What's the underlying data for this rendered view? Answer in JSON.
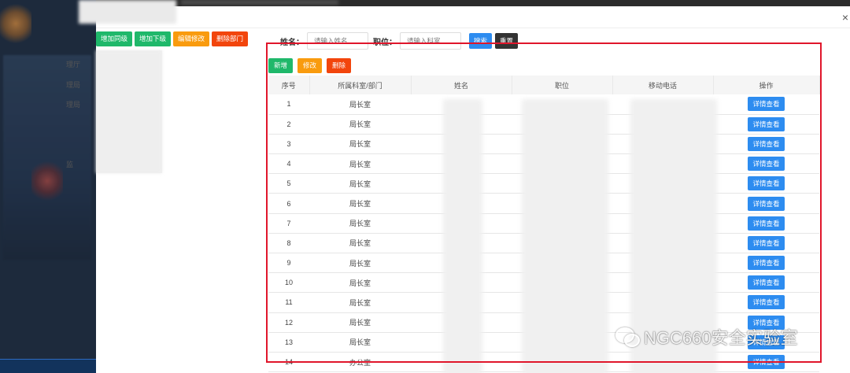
{
  "tree_toolbar": {
    "add_sibling": "增加同级",
    "add_child": "增加下级",
    "edit": "编辑修改",
    "delete_dept": "删除部门"
  },
  "tree": {
    "items": [
      "理厅",
      "理局",
      "理局",
      "监"
    ]
  },
  "search": {
    "name_label": "姓名：",
    "name_placeholder": "请输入姓名",
    "position_label": "职位：",
    "position_placeholder": "请输入科室",
    "search_button": "搜索",
    "reset_button": "重置"
  },
  "content_toolbar": {
    "add": "新增",
    "edit": "修改",
    "delete": "删除"
  },
  "table": {
    "headers": [
      "序号",
      "所属科室/部门",
      "姓名",
      "职位",
      "移动电话",
      "操作"
    ],
    "detail_label": "详情查看",
    "rows": [
      {
        "idx": "1",
        "dept": "局长室"
      },
      {
        "idx": "2",
        "dept": "局长室"
      },
      {
        "idx": "3",
        "dept": "局长室"
      },
      {
        "idx": "4",
        "dept": "局长室"
      },
      {
        "idx": "5",
        "dept": "局长室"
      },
      {
        "idx": "6",
        "dept": "局长室"
      },
      {
        "idx": "7",
        "dept": "局长室"
      },
      {
        "idx": "8",
        "dept": "局长室"
      },
      {
        "idx": "9",
        "dept": "局长室"
      },
      {
        "idx": "10",
        "dept": "局长室"
      },
      {
        "idx": "11",
        "dept": "局长室"
      },
      {
        "idx": "12",
        "dept": "局长室"
      },
      {
        "idx": "13",
        "dept": "局长室"
      },
      {
        "idx": "14",
        "dept": "办公室"
      }
    ]
  },
  "watermark": {
    "text": "NGC660安全实验室"
  },
  "colors": {
    "green": "#1fb86a",
    "orange": "#f99b0e",
    "red": "#f2450c",
    "blue": "#2d8cf0",
    "highlight": "#e0162b"
  }
}
